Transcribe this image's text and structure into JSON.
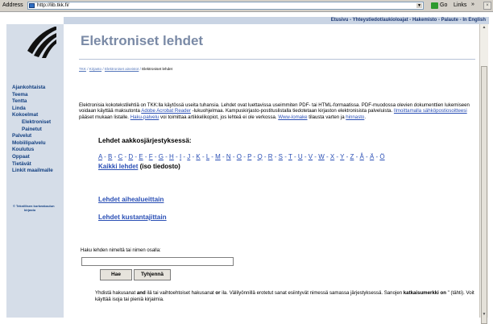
{
  "browser": {
    "address_label": "Address",
    "url": "http://lib.tkk.fi/",
    "go_label": "Go",
    "links_label": "Links",
    "links_arrows": "»"
  },
  "topnav": {
    "text": "Etusivu - Yhteystiedot/aukioloajat - Hakemisto - Palaute - In English"
  },
  "sidebar": {
    "items": [
      {
        "label": "Ajankohtaista"
      },
      {
        "label": "Teema"
      },
      {
        "label": "Tentta"
      },
      {
        "label": "Linda"
      },
      {
        "label": "Kokoelmat"
      },
      {
        "label": "Elektroniset"
      },
      {
        "label": "Painetut"
      },
      {
        "label": "Palvelut"
      },
      {
        "label": "Mobiilipalvelu"
      },
      {
        "label": "Koulutus"
      },
      {
        "label": "Oppaat"
      },
      {
        "label": "Tietävät"
      },
      {
        "label": "Linkit maailmalle"
      }
    ],
    "footer_line1": "© Teknillisen korkeakoulun",
    "footer_line2": "kirjasto"
  },
  "page": {
    "title": "Elektroniset lehdet",
    "breadcrumb": {
      "links": [
        "TKK",
        "Kirjasto",
        "Elektroniset aineistot"
      ],
      "current": "Elektroniset lehdet"
    },
    "intro": {
      "t1": "Elektronisia kokotekstilehtiä on TKK:lla käytössä useita tuhansia. Lehdet ovat luettavissa useimmiten PDF- tai HTML-formaatissa. PDF-muodossa olevien dokumenttien lukemiseen voidaan käyttää maksutonta ",
      "l1": "Adobe Acrobat Reader",
      "t2": " -lukuohjelmaa. Kampuskirjasto-postituslistalla tiedotetaan kirjaston elektronisista palveluista. ",
      "l2": "Ilmoittamalla sähköpostiosoitteesi",
      "t3": " pääset mukaan listalle. ",
      "l3": "Haku-palvelu",
      "t4": " voi toimittaa artikkelikopiot, jos lehteä ei ole verkossa. ",
      "l4": "Www-lomake",
      "t5": " tilausta varten ja ",
      "l5": "hinnasto",
      "t6": "."
    },
    "alpha_heading": "Lehdet aakkosjärjestyksessä:",
    "letters": [
      "A",
      "B",
      "C",
      "D",
      "E",
      "F",
      "G",
      "H",
      "I",
      "J",
      "K",
      "L",
      "M",
      "N",
      "O",
      "P",
      "Q",
      "R",
      "S",
      "T",
      "U",
      "V",
      "W",
      "X",
      "Y",
      "Z",
      "Å",
      "Ä",
      "Ö"
    ],
    "all_journals": "Kaikki lehdet",
    "all_journals_note": "(iso tiedosto)",
    "by_subject": "Lehdet aihealueittain",
    "by_publisher": "Lehdet kustantajittain",
    "search": {
      "label": "Haku lehden nimeltä tai nimen osalla:",
      "value": "",
      "search_button": "Hae",
      "clear_button": "Tyhjennä"
    },
    "help": {
      "p1": "Yhdistä hakusanat ",
      "and": "and",
      "p2": " ilä tai vaihtoehtoiset hakusanat ",
      "or": "or",
      "p3": " ila. Välilyönnillä erotetut sanat esiintyvät nimessä samassa järjestyksessä. Sanojen ",
      "trunc": "katkaisumerkki on",
      "p4": " \" (tähti). Voit käyttää isoja tai pieniä kirjaimia."
    }
  }
}
